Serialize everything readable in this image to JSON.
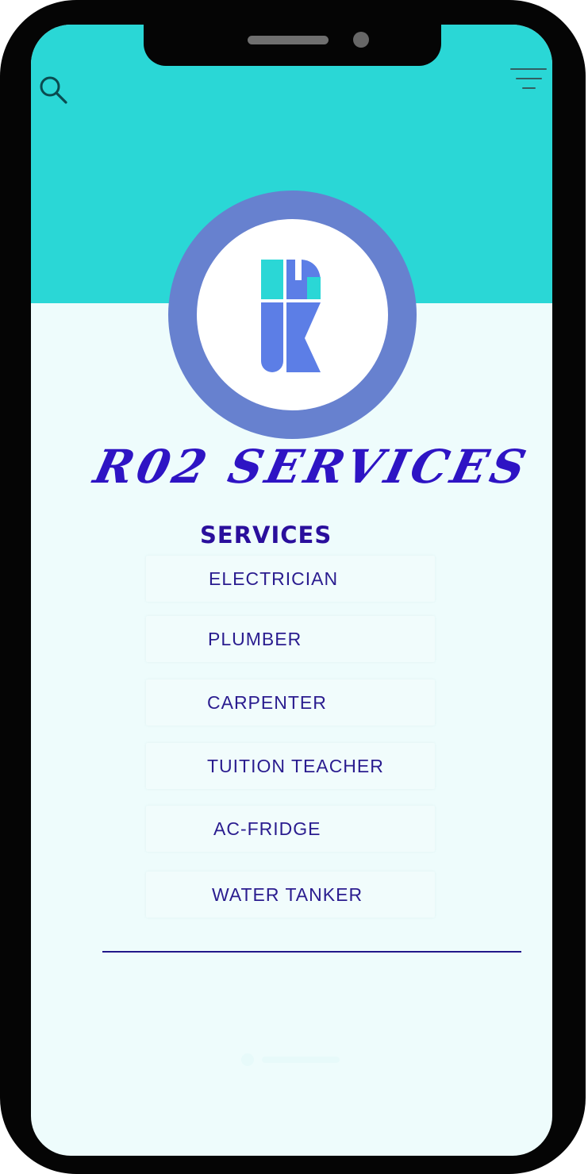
{
  "app": {
    "brand_name": "R02 SERVICES"
  },
  "header": {
    "search_icon": "search-icon",
    "filter_icon": "filter-icon"
  },
  "logo": {
    "mark_icon": "r-logo-icon",
    "colors": {
      "ring": "#6781cf",
      "mark_top": "#2ad7d6",
      "mark_bottom": "#5c7ee6"
    }
  },
  "services": {
    "title": "SERVICES",
    "items": [
      {
        "label": "ELECTRICIAN"
      },
      {
        "label": "PLUMBER"
      },
      {
        "label": "CARPENTER"
      },
      {
        "label": "TUITION TEACHER"
      },
      {
        "label": "AC-FRIDGE"
      },
      {
        "label": "WATER TANKER"
      }
    ]
  },
  "theme": {
    "header_color": "#2ad7d6",
    "screen_background": "#eefcfc",
    "text_color": "#2a1c8f",
    "brand_color": "#2e14c4",
    "phone_frame": "#050505"
  }
}
